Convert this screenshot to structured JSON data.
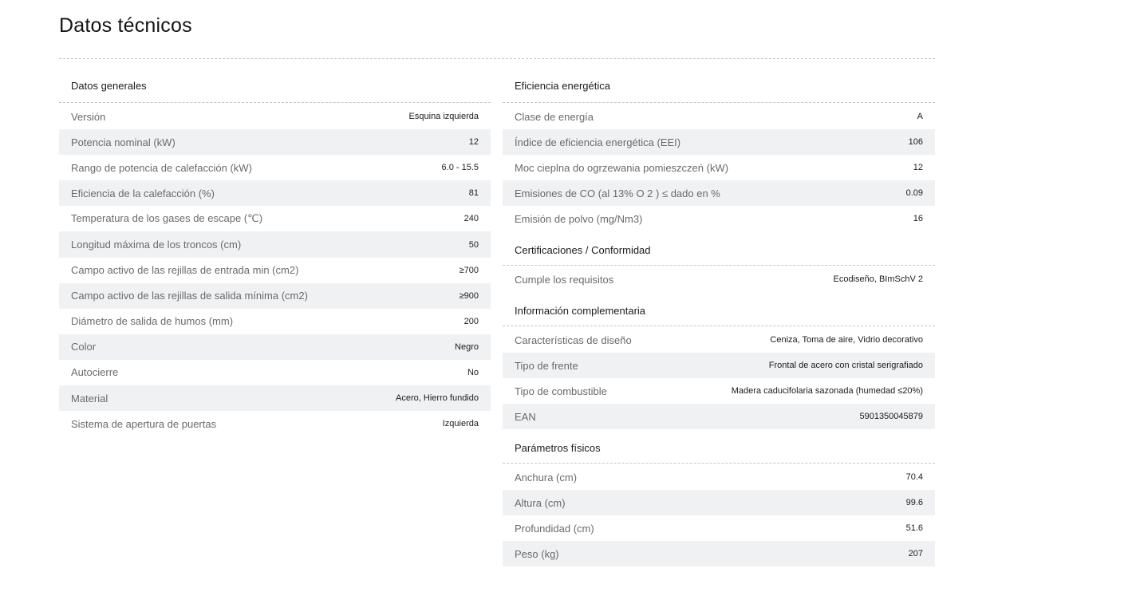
{
  "page_title": "Datos técnicos",
  "sections": {
    "generales": {
      "title": "Datos generales",
      "rows": [
        {
          "label": "Versión",
          "value": "Esquina izquierda"
        },
        {
          "label": "Potencia nominal (kW)",
          "value": "12"
        },
        {
          "label": "Rango de potencia de calefacción (kW)",
          "value": "6.0 - 15.5"
        },
        {
          "label": "Eficiencia de la calefacción (%)",
          "value": "81"
        },
        {
          "label": "Temperatura de los gases de escape (℃)",
          "value": "240"
        },
        {
          "label": "Longitud máxima de los troncos (cm)",
          "value": "50"
        },
        {
          "label": "Campo activo de las rejillas de entrada min (cm2)",
          "value": "≥700"
        },
        {
          "label": "Campo activo de las rejillas de salida mínima (cm2)",
          "value": "≥900"
        },
        {
          "label": "Diámetro de salida de humos (mm)",
          "value": "200"
        },
        {
          "label": "Color",
          "value": "Negro"
        },
        {
          "label": "Autocierre",
          "value": "No"
        },
        {
          "label": "Material",
          "value": "Acero, Hierro fundido"
        },
        {
          "label": "Sistema de apertura de puertas",
          "value": "Izquierda"
        }
      ]
    },
    "eficiencia": {
      "title": "Eficiencia energética",
      "rows": [
        {
          "label": "Clase de energía",
          "value": "A"
        },
        {
          "label": "Índice de eficiencia energética (EEI)",
          "value": "106"
        },
        {
          "label": "Moc cieplna do ogrzewania pomieszczeń (kW)",
          "value": "12"
        },
        {
          "label": "Emisiones de CO (al 13% O 2 ) ≤ dado en %",
          "value": "0.09"
        },
        {
          "label": "Emisión de polvo (mg/Nm3)",
          "value": "16"
        }
      ]
    },
    "certificaciones": {
      "title": "Certificaciones / Conformidad",
      "rows": [
        {
          "label": "Cumple los requisitos",
          "value": "Ecodiseño, BImSchV 2"
        }
      ]
    },
    "complementaria": {
      "title": "Información complementaria",
      "rows": [
        {
          "label": "Características de diseño",
          "value": "Ceniza, Toma de aire, Vidrio decorativo"
        },
        {
          "label": "Tipo de frente",
          "value": "Frontal de acero con cristal serigrafiado"
        },
        {
          "label": "Tipo de combustible",
          "value": "Madera caducifolaria sazonada (humedad ≤20%)"
        },
        {
          "label": "EAN",
          "value": "5901350045879"
        }
      ]
    },
    "fisicos": {
      "title": "Parámetros físicos",
      "rows": [
        {
          "label": "Anchura (cm)",
          "value": "70.4"
        },
        {
          "label": "Altura (cm)",
          "value": "99.6"
        },
        {
          "label": "Profundidad (cm)",
          "value": "51.6"
        },
        {
          "label": "Peso (kg)",
          "value": "207"
        }
      ]
    }
  }
}
